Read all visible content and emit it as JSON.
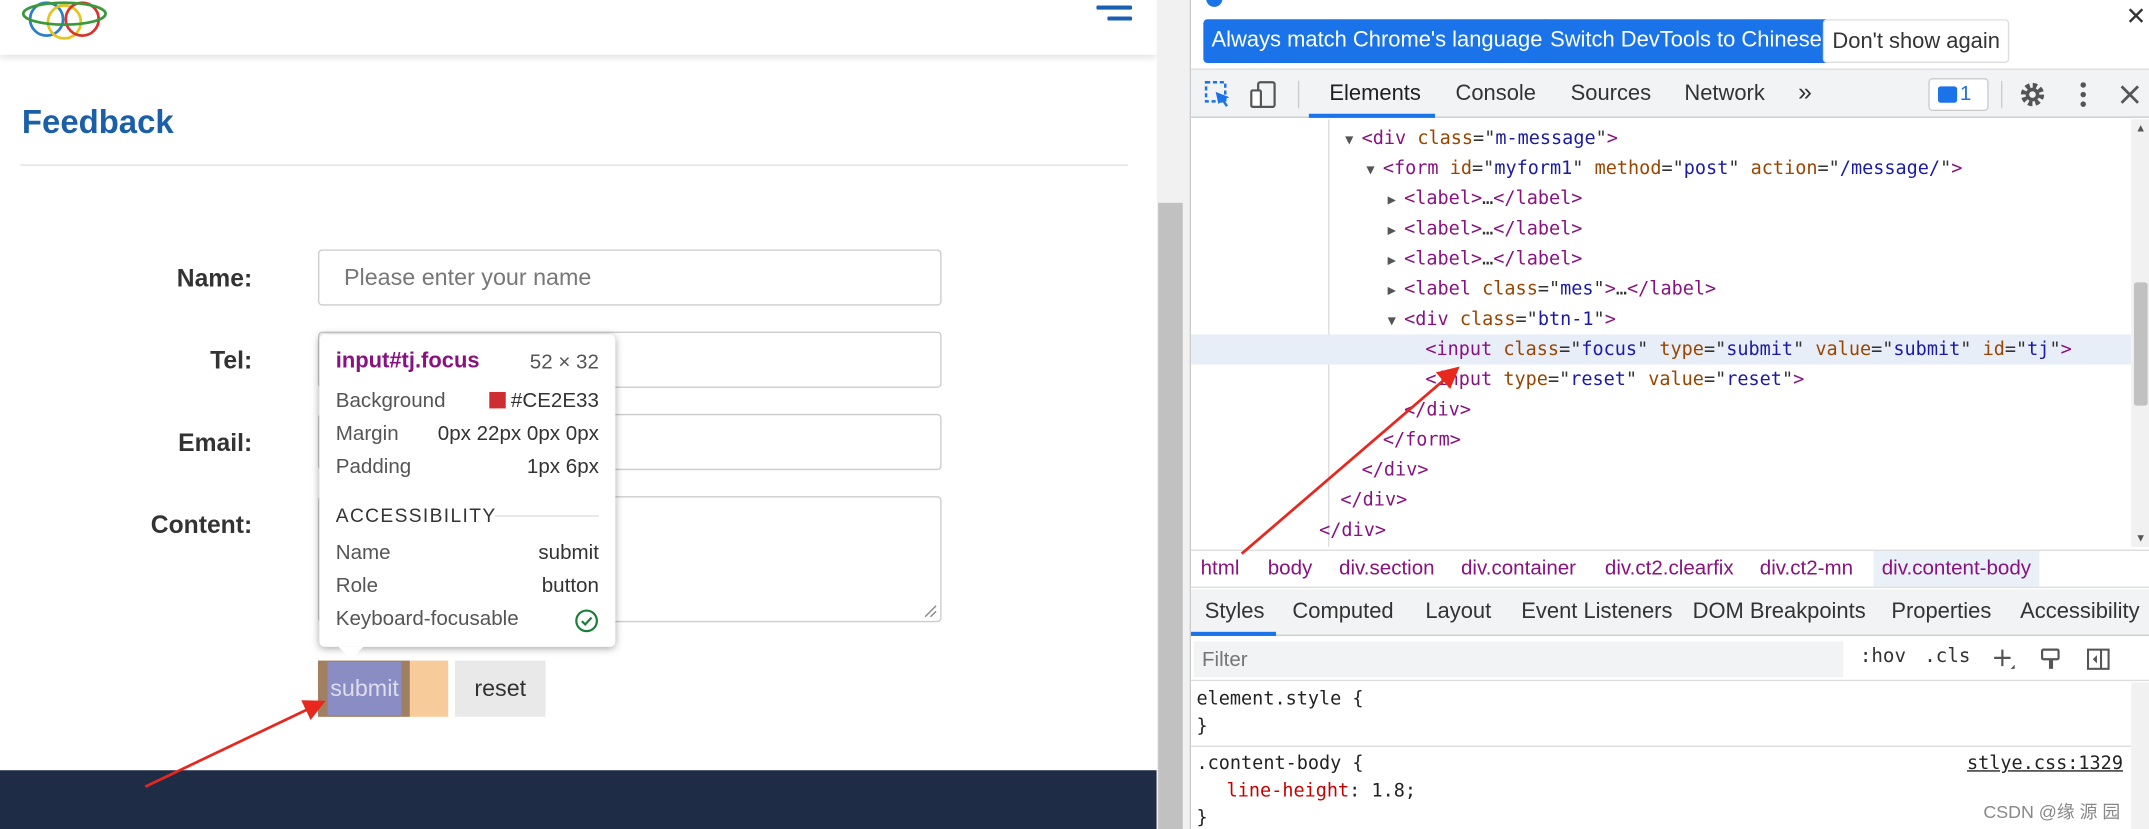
{
  "page": {
    "title": "Feedback",
    "form": {
      "name_label": "Name:",
      "name_placeholder": "Please enter your name",
      "tel_label": "Tel:",
      "email_label": "Email:",
      "content_label": "Content:",
      "submit_label": "submit",
      "reset_label": "reset"
    }
  },
  "tooltip": {
    "selector": "input#tj.focus",
    "size": "52 × 32",
    "rows": [
      {
        "key": "Background",
        "value": "#CE2E33"
      },
      {
        "key": "Margin",
        "value": "0px 22px 0px 0px"
      },
      {
        "key": "Padding",
        "value": "1px 6px"
      }
    ],
    "accessibility_title": "ACCESSIBILITY",
    "acc_rows": [
      {
        "key": "Name",
        "value": "submit"
      },
      {
        "key": "Role",
        "value": "button"
      },
      {
        "key": "Keyboard-focusable",
        "value": ""
      }
    ],
    "swatch_color": "#CE2E33"
  },
  "devtools": {
    "infobar": {
      "match_language": "Always match Chrome's language",
      "switch_chinese": "Switch DevTools to Chinese",
      "dont_show": "Don't show again"
    },
    "tabs": [
      "Elements",
      "Console",
      "Sources",
      "Network"
    ],
    "more_tabs": "»",
    "issues_count": "1",
    "dom": [
      {
        "indent": 7,
        "tri": "▼",
        "tag": "div",
        "attrs": [
          [
            "class",
            "m-message"
          ]
        ],
        "close": false
      },
      {
        "indent": 8,
        "tri": "▼",
        "tag": "form",
        "attrs": [
          [
            "id",
            "myform1"
          ],
          [
            "method",
            "post"
          ],
          [
            "action",
            "/message/"
          ]
        ],
        "close": false
      },
      {
        "indent": 9,
        "tri": "▶",
        "collapsed": "label",
        "attrs": []
      },
      {
        "indent": 9,
        "tri": "▶",
        "collapsed": "label",
        "attrs": []
      },
      {
        "indent": 9,
        "tri": "▶",
        "collapsed": "label",
        "attrs": []
      },
      {
        "indent": 9,
        "tri": "▶",
        "collapsed": "label",
        "attrs": [
          [
            "class",
            "mes"
          ]
        ]
      },
      {
        "indent": 9,
        "tri": "▼",
        "tag": "div",
        "attrs": [
          [
            "class",
            "btn-1"
          ]
        ],
        "close": false
      },
      {
        "indent": 10,
        "tri": "",
        "tag": "input",
        "attrs": [
          [
            "class",
            "focus"
          ],
          [
            "type",
            "submit"
          ],
          [
            "value",
            "submit"
          ],
          [
            "id",
            "tj"
          ]
        ],
        "selected": true
      },
      {
        "indent": 10,
        "tri": "",
        "tag": "input",
        "attrs": [
          [
            "type",
            "reset"
          ],
          [
            "value",
            "reset"
          ]
        ]
      },
      {
        "indent": 9,
        "tri": "",
        "end": "div"
      },
      {
        "indent": 8,
        "tri": "",
        "end": "form"
      },
      {
        "indent": 7,
        "tri": "",
        "end": "div"
      },
      {
        "indent": 6,
        "tri": "",
        "end": "div"
      },
      {
        "indent": 5,
        "tri": "",
        "end": "div"
      }
    ],
    "breadcrumbs": [
      "html",
      "body",
      "div.section",
      "div.container",
      "div.ct2.clearfix",
      "div.ct2-mn",
      "div.content-body"
    ],
    "subtabs": [
      "Styles",
      "Computed",
      "Layout",
      "Event Listeners",
      "DOM Breakpoints",
      "Properties",
      "Accessibility"
    ],
    "filter_placeholder": "Filter",
    "hov": ":hov",
    "cls": ".cls",
    "styles": {
      "element_style": "element.style {",
      "close_brace": "}",
      "rule_selector": ".content-body {",
      "rule_source": "stlye.css:1329",
      "prop_name": "line-height",
      "prop_value": "1.8;"
    },
    "watermark": "CSDN @缘 源 园"
  },
  "colors": {
    "accent": "#1a73e8",
    "title_blue": "#1b5fa8",
    "footer": "#1f2c45",
    "tag": "#881280",
    "attr_name": "#994500",
    "attr_value": "#1a1aa6",
    "arrow": "#e8281e"
  }
}
